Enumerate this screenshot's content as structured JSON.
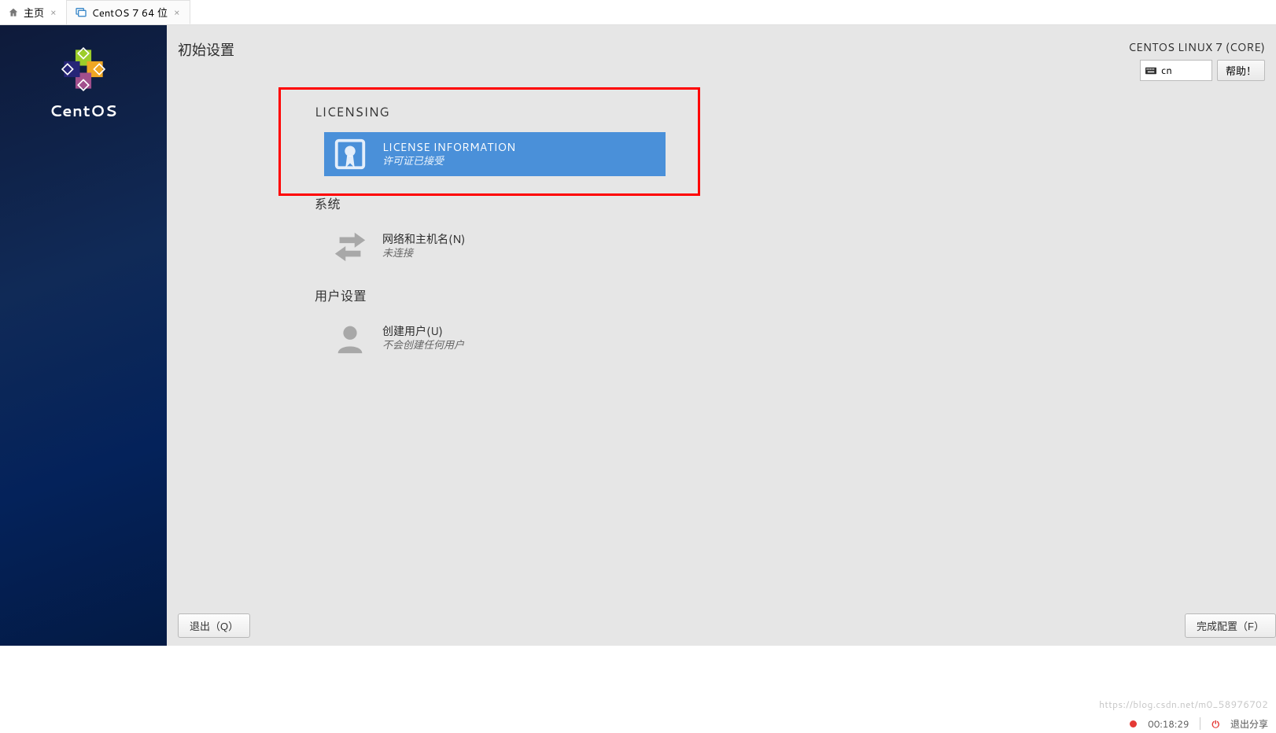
{
  "host_tabs": {
    "home": "主页",
    "vm": "CentOS 7 64 位"
  },
  "sidebar": {
    "distro_name": "CentOS"
  },
  "header": {
    "title": "初始设置",
    "os_name": "CENTOS LINUX 7 (CORE)",
    "keyboard_layout": "cn",
    "help_label": "帮助！"
  },
  "sections": {
    "licensing": {
      "heading": "LICENSING",
      "spoke_title": "LICENSE INFORMATION",
      "spoke_sub": "许可证已接受"
    },
    "system": {
      "heading": "系统",
      "spoke_title": "网络和主机名(N)",
      "spoke_sub": "未连接"
    },
    "users": {
      "heading": "用户设置",
      "spoke_title": "创建用户(U)",
      "spoke_sub": "不会创建任何用户"
    }
  },
  "footer": {
    "quit": "退出（Q）",
    "finish": "完成配置（F）"
  },
  "statusbar": {
    "time": "00:18:29",
    "exit_share": "退出分享"
  },
  "watermark": "https://blog.csdn.net/m0_58976702"
}
